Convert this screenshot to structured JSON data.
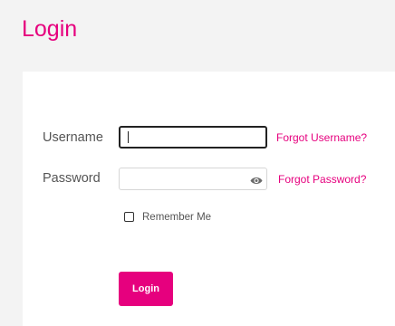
{
  "page": {
    "title": "Login"
  },
  "form": {
    "username_label": "Username",
    "username_value": "",
    "password_label": "Password",
    "password_value": "",
    "forgot_username_link": "Forgot Username?",
    "forgot_password_link": "Forgot Password?",
    "remember_me_label": "Remember Me",
    "remember_me_checked": false,
    "login_button_label": "Login",
    "password_toggle_icon": "eye-icon"
  },
  "colors": {
    "accent": "#e6007e",
    "page_background": "#f3f3f3",
    "panel_background": "#ffffff",
    "label_text": "#555555"
  }
}
